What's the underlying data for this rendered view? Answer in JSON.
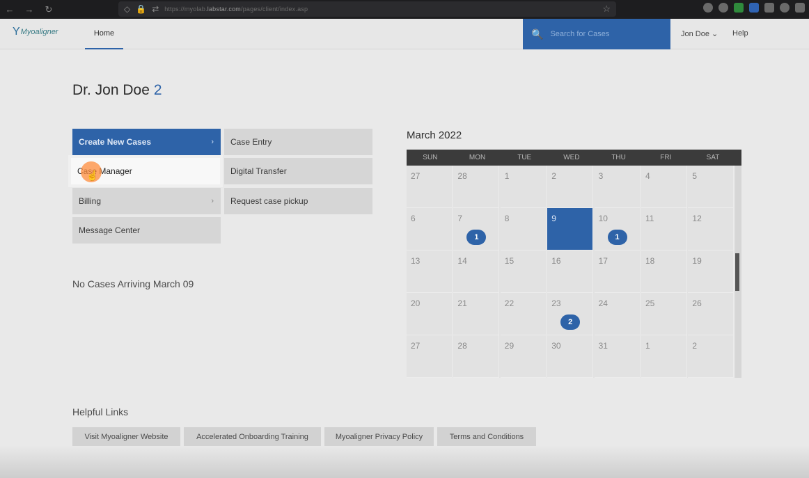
{
  "browser": {
    "url_prefix": "https://myolab.",
    "url_domain": "labstar.com",
    "url_path": "/pages/client/index.asp"
  },
  "header": {
    "logo_text": "Myoaligner",
    "home_label": "Home",
    "search_placeholder": "Search for Cases",
    "user_label": "Jon Doe ⌄",
    "help_label": "Help"
  },
  "main": {
    "doctor_name": "Dr. Jon Doe",
    "count": "2",
    "menu": [
      {
        "label": "Create New Cases",
        "chevron": "›"
      },
      {
        "label": "Case Manager"
      },
      {
        "label": "Billing",
        "chevron": "›"
      },
      {
        "label": "Message Center"
      }
    ],
    "submenu": [
      "Case Entry",
      "Digital Transfer",
      "Request case pickup"
    ],
    "no_cases_text": "No Cases Arriving March 09"
  },
  "calendar": {
    "title": "March 2022",
    "weekdays": [
      "SUN",
      "MON",
      "TUE",
      "WED",
      "THU",
      "FRI",
      "SAT"
    ],
    "weeks": [
      [
        "27",
        "28",
        "1",
        "2",
        "3",
        "4",
        "5"
      ],
      [
        "6",
        "7",
        "8",
        "9",
        "10",
        "11",
        "12"
      ],
      [
        "13",
        "14",
        "15",
        "16",
        "17",
        "18",
        "19"
      ],
      [
        "20",
        "21",
        "22",
        "23",
        "24",
        "25",
        "26"
      ],
      [
        "27",
        "28",
        "29",
        "30",
        "31",
        "1",
        "2"
      ]
    ],
    "selected_day": "9",
    "badges": {
      "7": "1",
      "10": "1",
      "23": "2"
    }
  },
  "links": {
    "title": "Helpful Links",
    "items": [
      "Visit Myoaligner Website",
      "Accelerated Onboarding Training",
      "Myoaligner Privacy Policy",
      "Terms and Conditions"
    ]
  }
}
